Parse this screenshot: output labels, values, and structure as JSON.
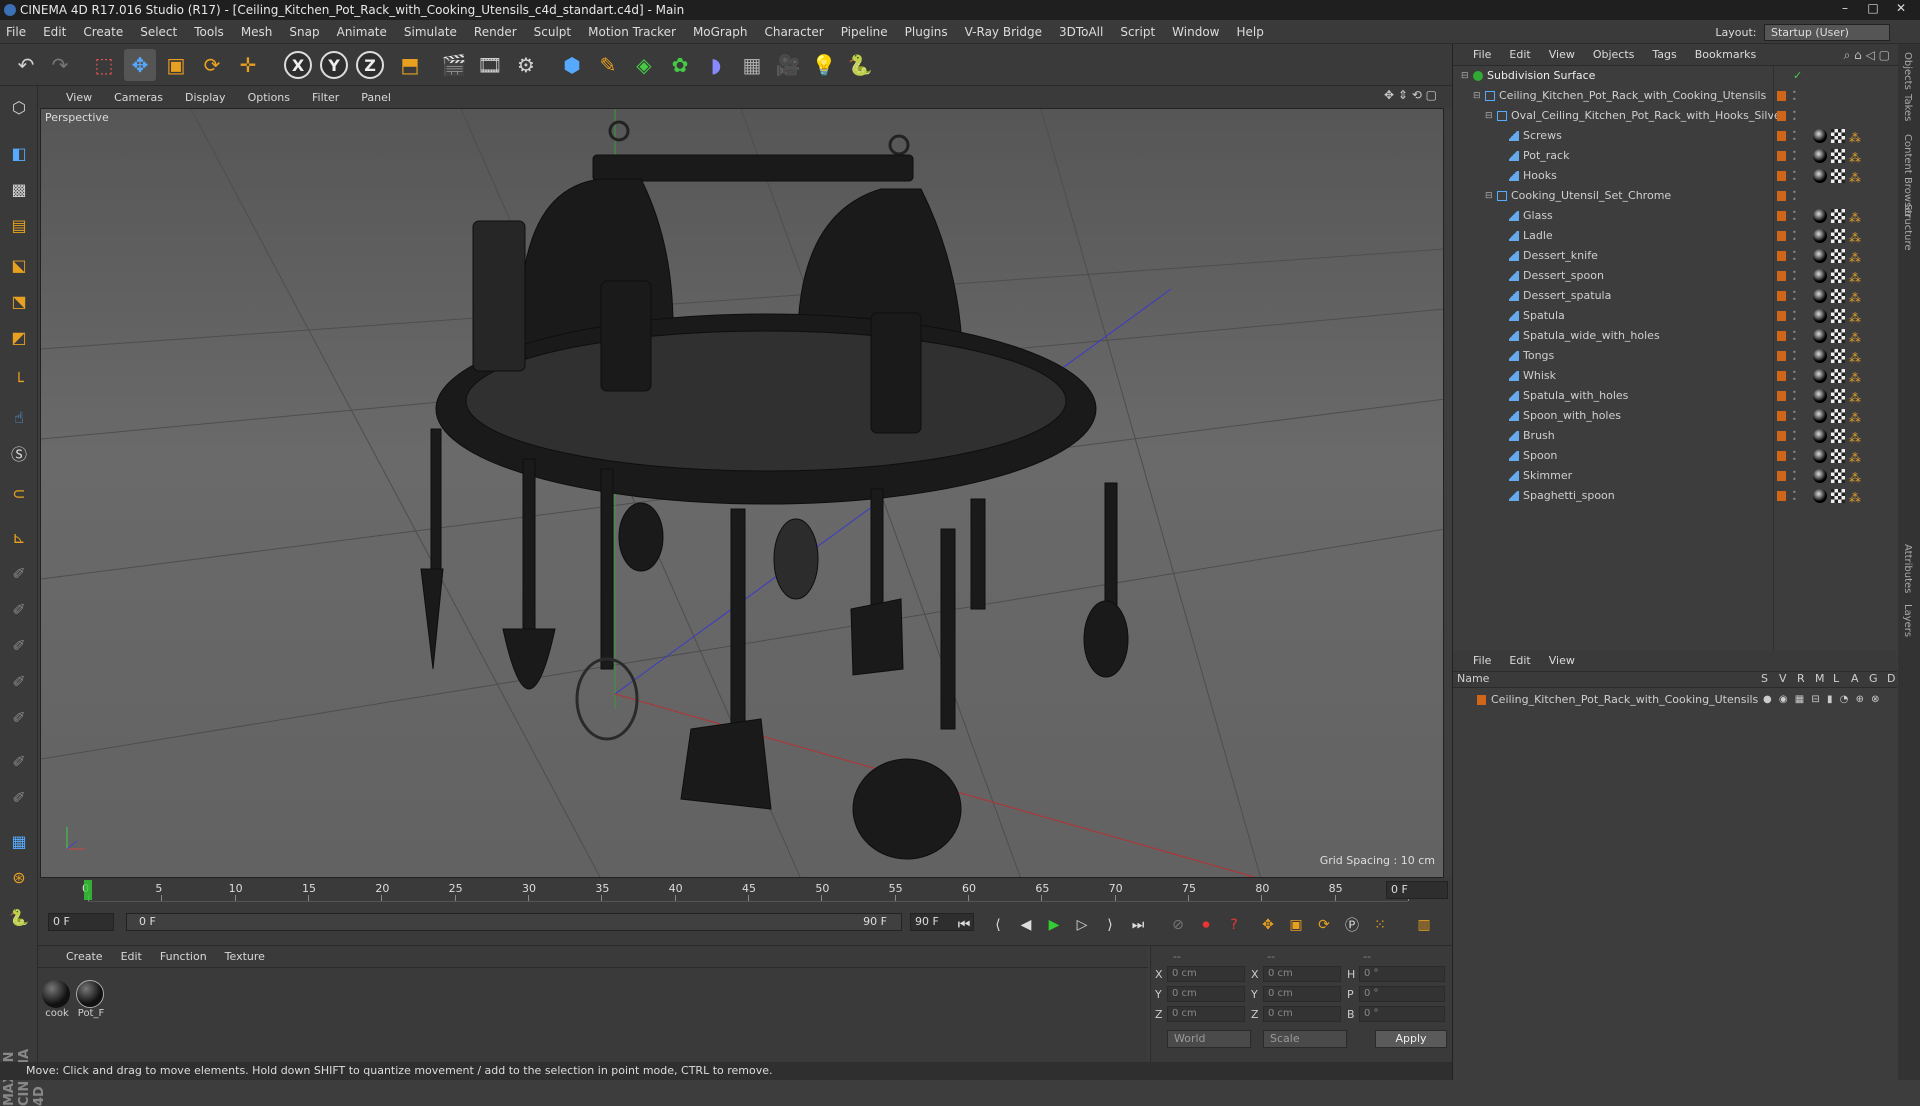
{
  "window": {
    "title": "CINEMA 4D R17.016 Studio (R17) - [Ceiling_Kitchen_Pot_Rack_with_Cooking_Utensils_c4d_standart.c4d] - Main"
  },
  "menu": [
    "File",
    "Edit",
    "Create",
    "Select",
    "Tools",
    "Mesh",
    "Snap",
    "Animate",
    "Simulate",
    "Render",
    "Sculpt",
    "Motion Tracker",
    "MoGraph",
    "Character",
    "Pipeline",
    "Plugins",
    "V-Ray Bridge",
    "3DToAll",
    "Script",
    "Window",
    "Help"
  ],
  "layout": {
    "label": "Layout:",
    "value": "Startup (User)"
  },
  "viewport": {
    "menu": [
      "View",
      "Cameras",
      "Display",
      "Options",
      "Filter",
      "Panel"
    ],
    "label": "Perspective",
    "grid_spacing": "Grid Spacing : 10 cm"
  },
  "timeline": {
    "ticks": [
      "0",
      "5",
      "10",
      "15",
      "20",
      "25",
      "30",
      "35",
      "40",
      "45",
      "50",
      "55",
      "60",
      "65",
      "70",
      "75",
      "80",
      "85",
      "90"
    ],
    "current_frame": "0 F",
    "start_field": "0 F",
    "range_start": "0 F",
    "range_end": "90 F",
    "end_field": "90 F"
  },
  "materials": {
    "menu": [
      "Create",
      "Edit",
      "Function",
      "Texture"
    ],
    "items": [
      "cook",
      "Pot_F"
    ]
  },
  "coords": {
    "header": [
      "--",
      "--",
      "--"
    ],
    "rows": [
      {
        "a": "X",
        "av": "0 cm",
        "b": "X",
        "bv": "0 cm",
        "c": "H",
        "cv": "0 °"
      },
      {
        "a": "Y",
        "av": "0 cm",
        "b": "Y",
        "bv": "0 cm",
        "c": "P",
        "cv": "0 °"
      },
      {
        "a": "Z",
        "av": "0 cm",
        "b": "Z",
        "bv": "0 cm",
        "c": "B",
        "cv": "0 °"
      }
    ],
    "world": "World",
    "scale": "Scale",
    "apply": "Apply"
  },
  "status": "Move: Click and drag to move elements. Hold down SHIFT to quantize movement / add to the selection in point mode, CTRL to remove.",
  "objects": {
    "menu": [
      "File",
      "Edit",
      "View",
      "Objects",
      "Tags",
      "Bookmarks"
    ],
    "items": [
      {
        "name": "Subdivision Surface",
        "level": 0,
        "tags": 0
      },
      {
        "name": "Ceiling_Kitchen_Pot_Rack_with_Cooking_Utensils",
        "level": 1,
        "tags": 0
      },
      {
        "name": "Oval_Ceiling_Kitchen_Pot_Rack_with_Hooks_Silver",
        "level": 2,
        "tags": 0
      },
      {
        "name": "Screws",
        "level": 3,
        "tags": 3
      },
      {
        "name": "Pot_rack",
        "level": 3,
        "tags": 3
      },
      {
        "name": "Hooks",
        "level": 3,
        "tags": 3
      },
      {
        "name": "Cooking_Utensil_Set_Chrome",
        "level": 2,
        "tags": 0
      },
      {
        "name": "Glass",
        "level": 3,
        "tags": 3
      },
      {
        "name": "Ladle",
        "level": 3,
        "tags": 3
      },
      {
        "name": "Dessert_knife",
        "level": 3,
        "tags": 3
      },
      {
        "name": "Dessert_spoon",
        "level": 3,
        "tags": 3
      },
      {
        "name": "Dessert_spatula",
        "level": 3,
        "tags": 3
      },
      {
        "name": "Spatula",
        "level": 3,
        "tags": 3
      },
      {
        "name": "Spatula_wide_with_holes",
        "level": 3,
        "tags": 3
      },
      {
        "name": "Tongs",
        "level": 3,
        "tags": 3
      },
      {
        "name": "Whisk",
        "level": 3,
        "tags": 3
      },
      {
        "name": "Spatula_with_holes",
        "level": 3,
        "tags": 3
      },
      {
        "name": "Spoon_with_holes",
        "level": 3,
        "tags": 3
      },
      {
        "name": "Brush",
        "level": 3,
        "tags": 3
      },
      {
        "name": "Spoon",
        "level": 3,
        "tags": 3
      },
      {
        "name": "Skimmer",
        "level": 3,
        "tags": 3
      },
      {
        "name": "Spaghetti_spoon",
        "level": 3,
        "tags": 3
      }
    ]
  },
  "layers": {
    "menu": [
      "File",
      "Edit",
      "View"
    ],
    "header_name": "Name",
    "columns": [
      "S",
      "V",
      "R",
      "M",
      "L",
      "A",
      "G",
      "D"
    ],
    "item": "Ceiling_Kitchen_Pot_Rack_with_Cooking_Utensils"
  },
  "side_tabs": [
    "Objects",
    "Takes",
    "Content Browser",
    "Structure",
    "Attributes",
    "Layers"
  ],
  "brand": "MAXON CINEMA 4D",
  "colors": {
    "accent": "#d0661a",
    "selection": "#5b8fd6"
  }
}
